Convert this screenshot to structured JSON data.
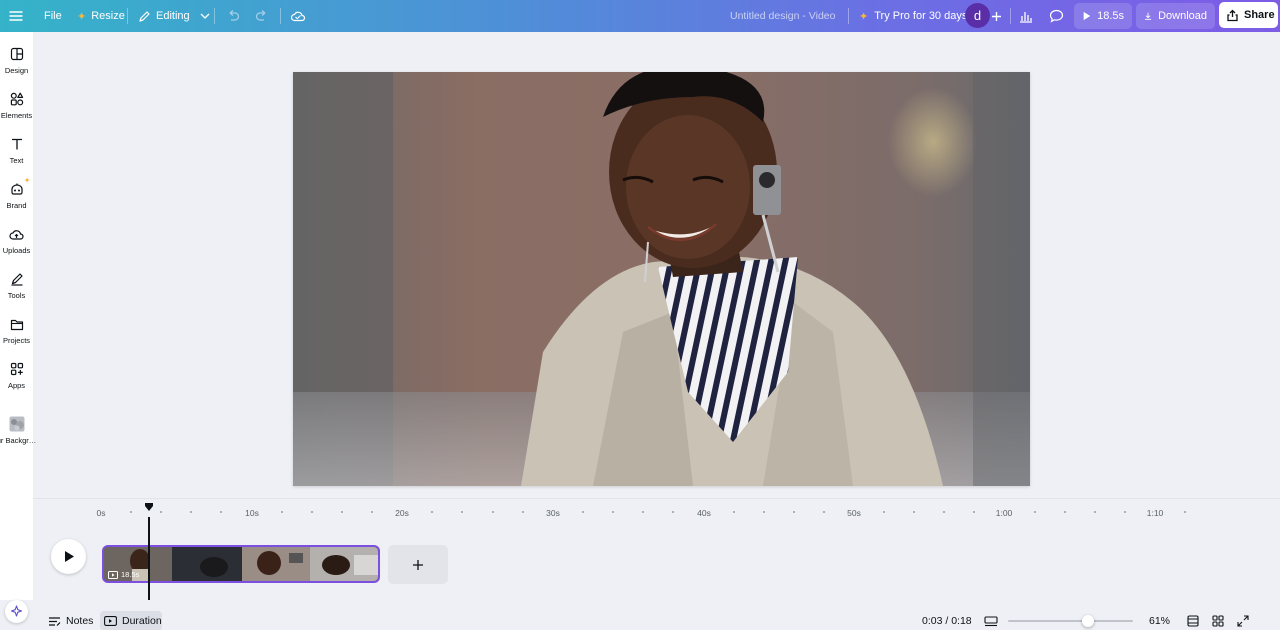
{
  "topbar": {
    "file_label": "File",
    "resize_label": "Resize",
    "editing_label": "Editing",
    "design_title": "Untitled design - Video",
    "pro_label": "Try Pro for 30 days",
    "avatar_letter": "d",
    "play_duration": "18.5s",
    "download_label": "Download",
    "share_label": "Share"
  },
  "sidebar": {
    "items": [
      {
        "label": "Design",
        "icon": "layout-icon"
      },
      {
        "label": "Elements",
        "icon": "shapes-icon"
      },
      {
        "label": "Text",
        "icon": "text-icon"
      },
      {
        "label": "Brand",
        "icon": "brand-icon"
      },
      {
        "label": "Uploads",
        "icon": "cloud-upload-icon"
      },
      {
        "label": "Tools",
        "icon": "pen-icon"
      },
      {
        "label": "Projects",
        "icon": "folder-icon"
      },
      {
        "label": "Apps",
        "icon": "apps-icon"
      },
      {
        "label": "ur Backgr…",
        "icon": "blur-background-icon"
      }
    ]
  },
  "timeline": {
    "ruler": [
      "0s",
      "10s",
      "20s",
      "30s",
      "40s",
      "50s",
      "1:00",
      "1:10"
    ],
    "clip_duration": "18.5s",
    "playhead_seconds": 3
  },
  "bottombar": {
    "notes_label": "Notes",
    "duration_label": "Duration",
    "time_readout": "0:03 / 0:18",
    "zoom_percent": "61%",
    "zoom_level": 0.61
  },
  "colors": {
    "accent_purple": "#7d4fe0",
    "avatar_purple": "#5a2ea6",
    "pro_star": "#f4b740"
  }
}
